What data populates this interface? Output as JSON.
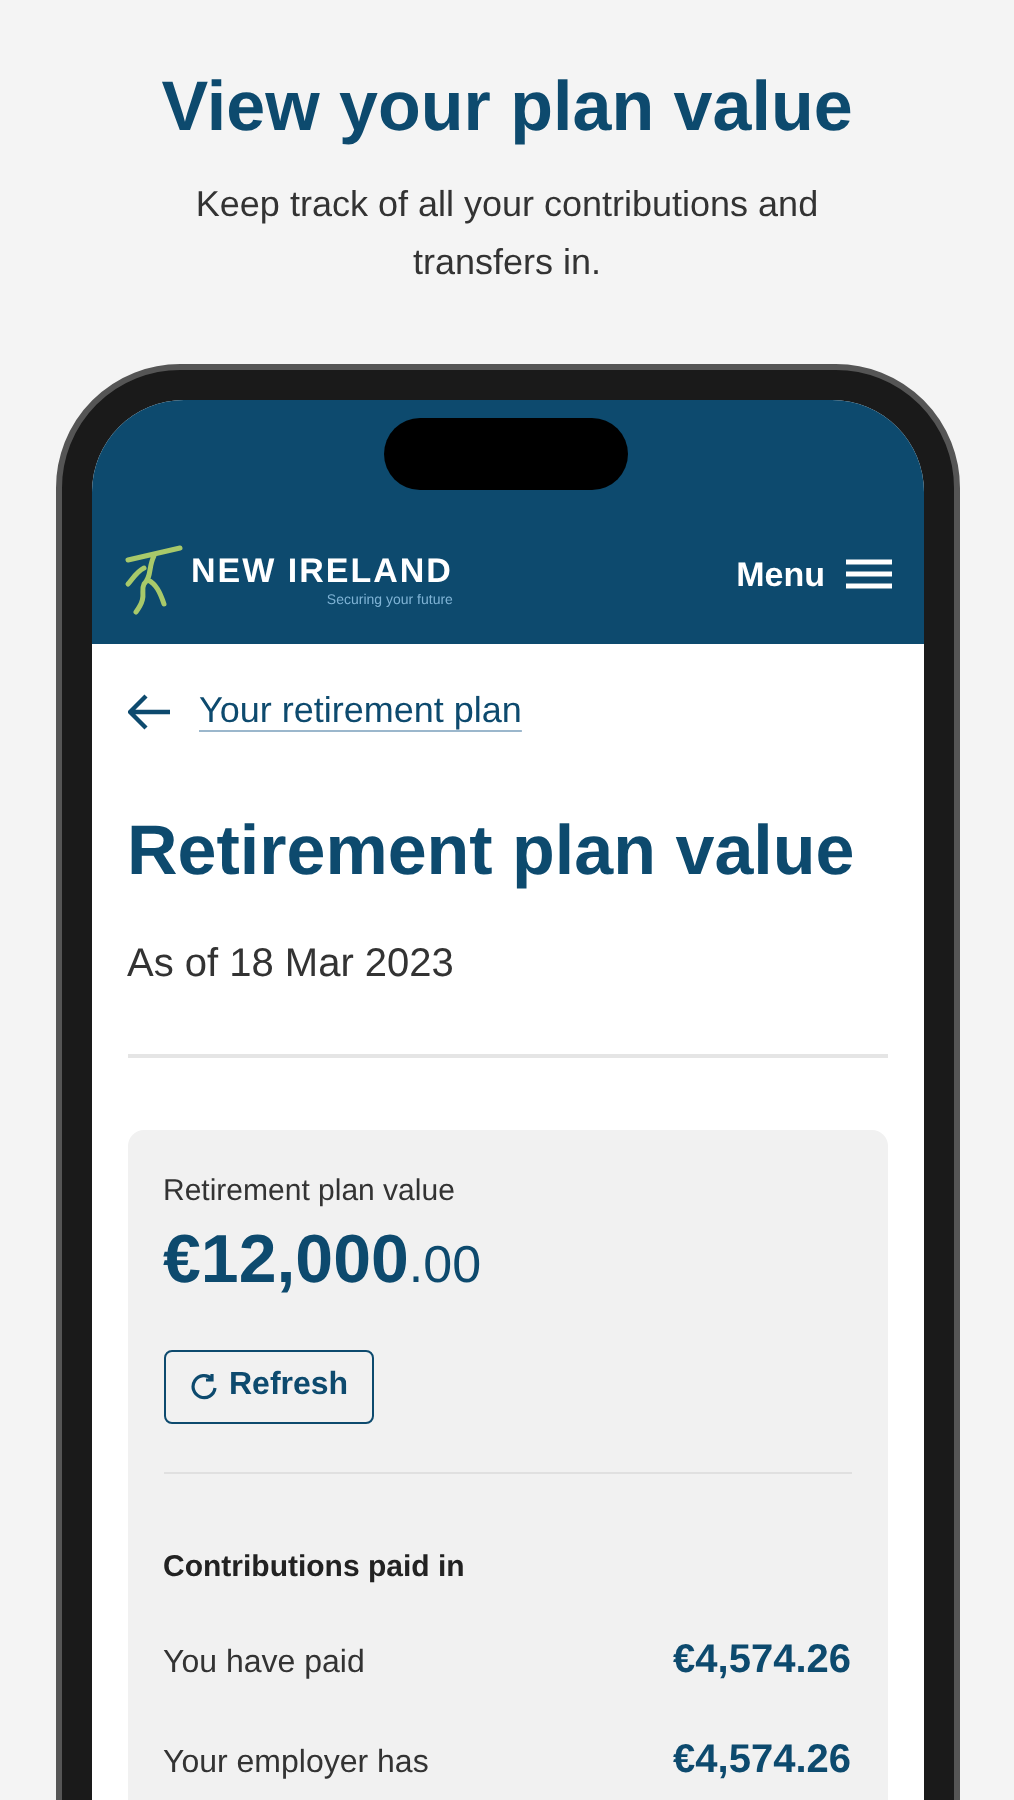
{
  "promo": {
    "title": "View your plan value",
    "subtitle": "Keep track of all your contributions and transfers in."
  },
  "header": {
    "brand": "NEW IRELAND",
    "tagline": "Securing your future",
    "menu": "Menu"
  },
  "back_link": "Your retirement plan",
  "page": {
    "title": "Retirement plan value",
    "date": "As of 18 Mar 2023"
  },
  "value_card": {
    "label": "Retirement plan value",
    "amount_main": "€12,000",
    "amount_decimal": ".00",
    "refresh_button": "Refresh",
    "section_title": "Contributions paid in",
    "rows": [
      {
        "label": "You have paid",
        "amount": "€4,574.26"
      },
      {
        "label": "Your employer has",
        "amount": "€4,574.26"
      }
    ]
  }
}
